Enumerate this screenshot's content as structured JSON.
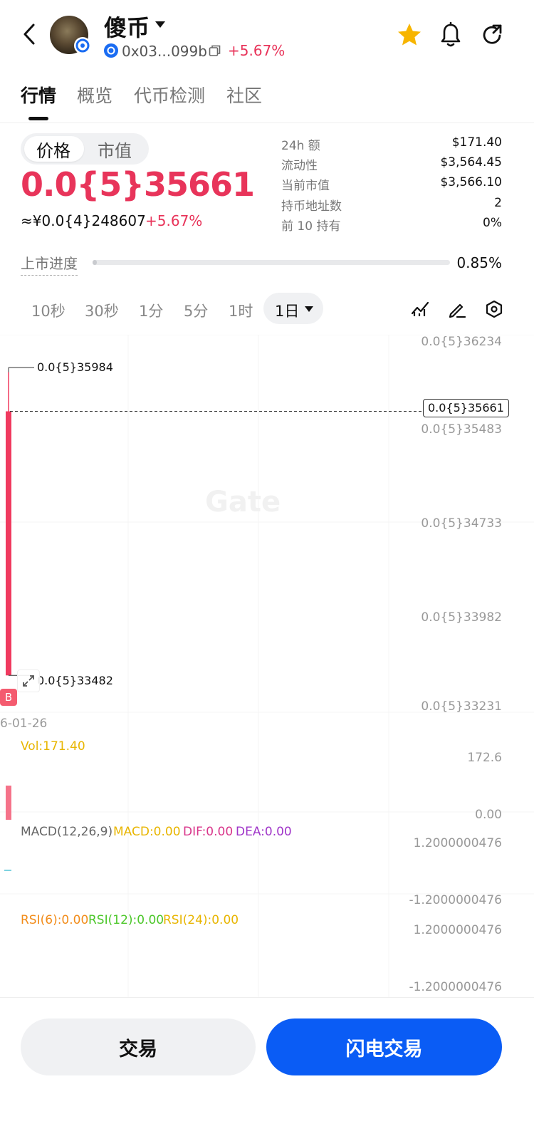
{
  "header": {
    "title": "傻币",
    "address": "0x03...099b",
    "change": "+5.67%"
  },
  "tabs": [
    "行情",
    "概览",
    "代币检测",
    "社区"
  ],
  "price_toggle": {
    "price_label": "价格",
    "mcap_label": "市值"
  },
  "price": {
    "main": "0.0{5}35661",
    "cny": "≈¥0.0{4}248607",
    "change": "+5.67%"
  },
  "stats": [
    {
      "label": "24h  额",
      "value": "$171.40"
    },
    {
      "label": "流动性",
      "value": "$3,564.45"
    },
    {
      "label": "当前市值",
      "value": "$3,566.10"
    },
    {
      "label": "持币地址数",
      "value": "2"
    },
    {
      "label": "前 10 持有",
      "value": "0%"
    }
  ],
  "progress": {
    "label": "上市进度",
    "value": "0.85%",
    "fraction": 0.0085
  },
  "intervals": [
    "10秒",
    "30秒",
    "1分",
    "5分",
    "1时"
  ],
  "active_interval": "1日",
  "chart": {
    "watermark": "Gate",
    "y_ticks": [
      "0.0{5}36234",
      "0.0{5}35483",
      "0.0{5}34733",
      "0.0{5}33982",
      "0.0{5}33231"
    ],
    "high_label": "0.0{5}35984",
    "low_label": "0.0{5}33482",
    "last_price_label": "0.0{5}35661",
    "date_label": "6-01-26",
    "marker": "B"
  },
  "chart_data": {
    "type": "candlestick",
    "x": [
      "6-01-26"
    ],
    "open": [
      3.3482e-06
    ],
    "high": [
      3.5984e-06
    ],
    "low": [
      3.3482e-06
    ],
    "close": [
      3.5661e-06
    ],
    "volume": [
      171.4
    ],
    "ylim": [
      3.3231e-06,
      3.6234e-06
    ],
    "colors": {
      "up": "#f03a5f",
      "down": "#21b573"
    }
  },
  "indicators": {
    "vol": {
      "label": "Vol:171.40",
      "max": "172.6",
      "zero": "0.00",
      "color": "#e8b500"
    },
    "macd": {
      "name": "MACD(12,26,9)",
      "macd": "MACD:0.00",
      "dif": "DIF:0.00",
      "dea": "DEA:0.00",
      "max": "1.2000000476",
      "min": "-1.2000000476"
    },
    "rsi": {
      "rsi6": "RSI(6):0.00",
      "rsi12": "RSI(12):0.00",
      "rsi24": "RSI(24):0.00",
      "max": "1.2000000476",
      "min": "-1.2000000476"
    }
  },
  "buttons": {
    "trade": "交易",
    "flash_trade": "闪电交易"
  },
  "colors": {
    "accent_red": "#e8345a",
    "primary_blue": "#0a5cf5",
    "star": "#f7b500"
  }
}
